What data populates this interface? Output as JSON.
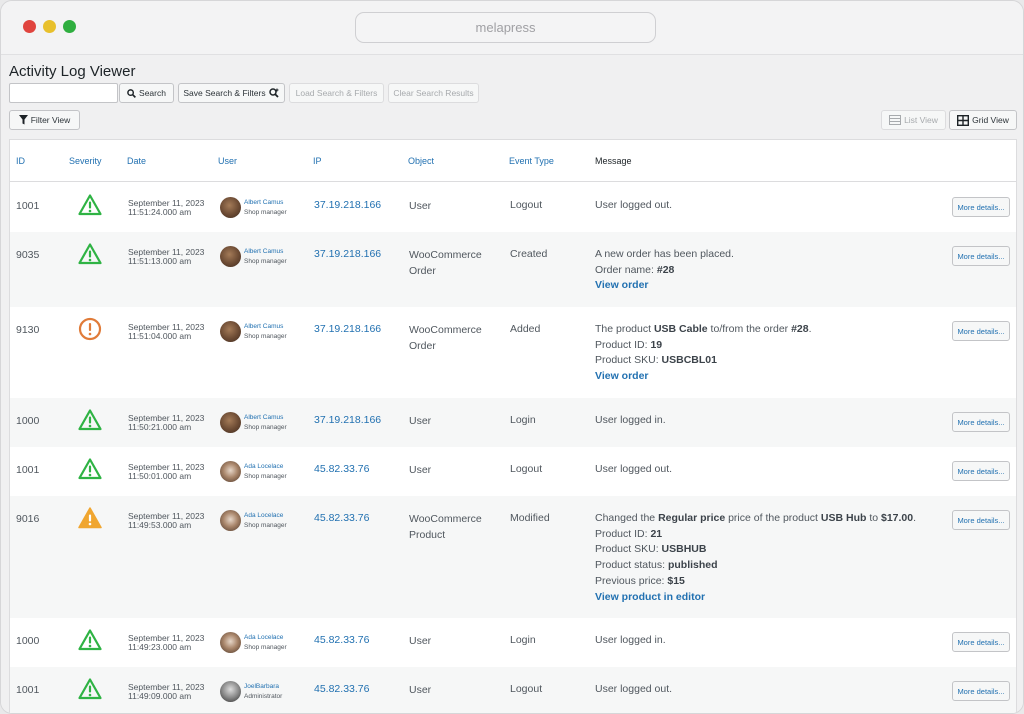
{
  "window": {
    "url": "melapress"
  },
  "page": {
    "title": "Activity Log Viewer"
  },
  "toolbar": {
    "search_placeholder": "",
    "search_label": "Search",
    "save_label": "Save Search & Filters",
    "load_label": "Load Search & Filters",
    "clear_label": "Clear Search Results",
    "filter_view_label": "Filter View",
    "list_view_label": "List View",
    "grid_view_label": "Grid View"
  },
  "columns": [
    "ID",
    "Severity",
    "Date",
    "User",
    "IP",
    "Object",
    "Event Type",
    "Message"
  ],
  "more_label": "More details...",
  "rows": [
    {
      "id": "1001",
      "severity": "low",
      "date": "September 11, 2023",
      "time": "11:51:24.000 am",
      "user": "Albert Camus",
      "role": "Shop manager",
      "ip": "37.19.218.166",
      "object1": "User",
      "object2": "",
      "event": "Logout",
      "message": [
        "User logged out."
      ]
    },
    {
      "id": "9035",
      "severity": "low",
      "date": "September 11, 2023",
      "time": "11:51:13.000 am",
      "user": "Albert Camus",
      "role": "Shop manager",
      "ip": "37.19.218.166",
      "object1": "WooCommerce",
      "object2": "Order",
      "event": "Created",
      "message": [
        "A new order has been placed.",
        "Order name: ",
        "#28",
        "View order"
      ]
    },
    {
      "id": "9130",
      "severity": "medium",
      "date": "September 11, 2023",
      "time": "11:51:04.000 am",
      "user": "Albert Camus",
      "role": "Shop manager",
      "ip": "37.19.218.166",
      "object1": "WooCommerce",
      "object2": "Order",
      "event": "Added",
      "message": [
        "The product ",
        "USB Cable",
        " to/from the order ",
        "#28",
        ".",
        "Product ID: ",
        "19",
        "Product SKU: ",
        "USBCBL01",
        "View order"
      ]
    },
    {
      "id": "1000",
      "severity": "low",
      "date": "September 11, 2023",
      "time": "11:50:21.000 am",
      "user": "Albert Camus",
      "role": "Shop manager",
      "ip": "37.19.218.166",
      "object1": "User",
      "object2": "",
      "event": "Login",
      "message": [
        "User logged in."
      ]
    },
    {
      "id": "1001",
      "severity": "low",
      "date": "September 11, 2023",
      "time": "11:50:01.000 am",
      "user": "Ada Locelace",
      "role": "Shop manager",
      "ip": "45.82.33.76",
      "object1": "User",
      "object2": "",
      "event": "Logout",
      "message": [
        "User logged out."
      ]
    },
    {
      "id": "9016",
      "severity": "high",
      "date": "September 11, 2023",
      "time": "11:49:53.000 am",
      "user": "Ada Locelace",
      "role": "Shop manager",
      "ip": "45.82.33.76",
      "object1": "WooCommerce",
      "object2": "Product",
      "event": "Modified",
      "message": [
        "Changed the ",
        "Regular price",
        " price of the product ",
        "USB Hub",
        " to ",
        "$17.00",
        ".",
        "Product ID: ",
        "21",
        "Product SKU: ",
        "USBHUB",
        "Product status: ",
        "published",
        "Previous price: ",
        "$15",
        "View product in editor"
      ]
    },
    {
      "id": "1000",
      "severity": "low",
      "date": "September 11, 2023",
      "time": "11:49:23.000 am",
      "user": "Ada Locelace",
      "role": "Shop manager",
      "ip": "45.82.33.76",
      "object1": "User",
      "object2": "",
      "event": "Login",
      "message": [
        "User logged in."
      ]
    },
    {
      "id": "1001",
      "severity": "low",
      "date": "September 11, 2023",
      "time": "11:49:09.000 am",
      "user": "JoelBarbara",
      "role": "Administrator",
      "ip": "45.82.33.76",
      "object1": "User",
      "object2": "",
      "event": "Logout",
      "message": [
        "User logged out."
      ]
    }
  ],
  "colors": {
    "link": "#2271b1",
    "low": "#2fb344",
    "medium": "#e07b39",
    "high": "#f0a630"
  }
}
